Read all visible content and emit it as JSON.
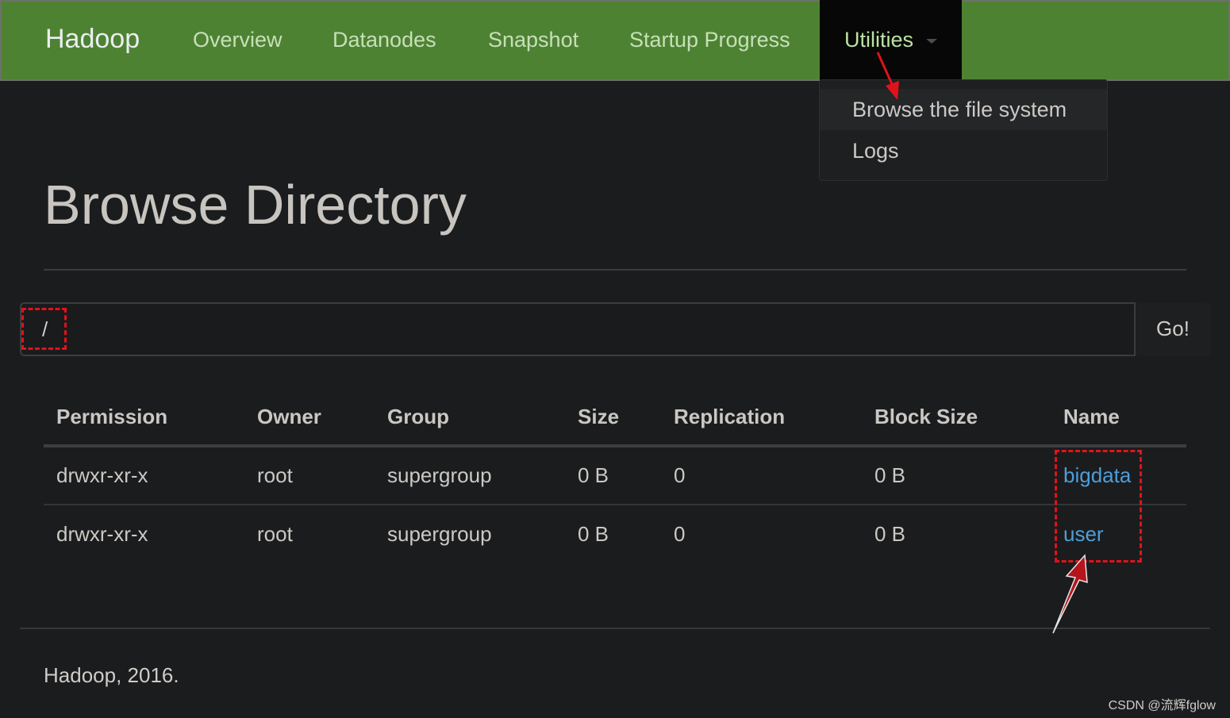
{
  "navbar": {
    "brand": "Hadoop",
    "items": [
      "Overview",
      "Datanodes",
      "Snapshot",
      "Startup Progress"
    ],
    "active": "Utilities",
    "colors": {
      "bg": "#4e8233",
      "active_bg": "#060706"
    }
  },
  "dropdown": {
    "items": [
      "Browse the file system",
      "Logs"
    ]
  },
  "page": {
    "title": "Browse Directory"
  },
  "path_bar": {
    "value": "/",
    "button": "Go!"
  },
  "table": {
    "headers": [
      "Permission",
      "Owner",
      "Group",
      "Size",
      "Replication",
      "Block Size",
      "Name"
    ],
    "rows": [
      [
        "drwxr-xr-x",
        "root",
        "supergroup",
        "0 B",
        "0",
        "0 B",
        "bigdata"
      ],
      [
        "drwxr-xr-x",
        "root",
        "supergroup",
        "0 B",
        "0",
        "0 B",
        "user"
      ]
    ]
  },
  "footer": "Hadoop, 2016.",
  "watermark": "CSDN @流辉fglow",
  "annotation_color": "#e0131a"
}
